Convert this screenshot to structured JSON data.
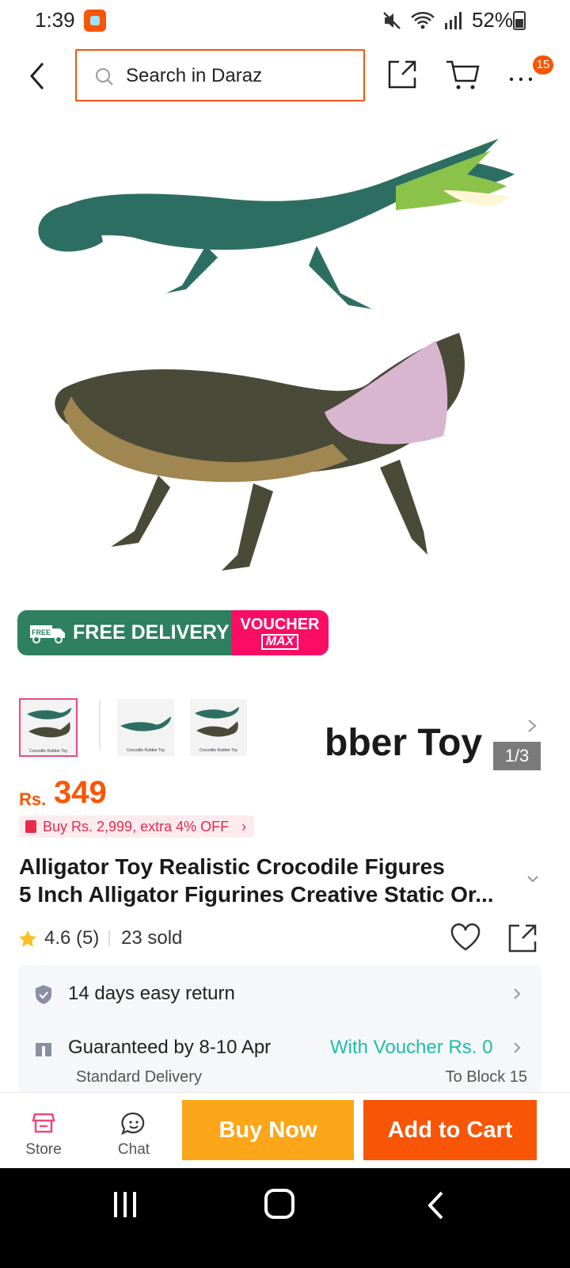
{
  "status_bar": {
    "time": "1:39",
    "battery": "52%"
  },
  "search": {
    "placeholder": "Search in Daraz"
  },
  "more_badge": "15",
  "hero": {
    "caption_fragment": "bber Toy",
    "image_counter": "1/3",
    "promo_free": "FREE DELIVERY",
    "promo_free_tag": "FREE",
    "promo_voucher_line1": "VOUCHER",
    "promo_voucher_line2": "MAX"
  },
  "thumbnails": [
    {
      "caption": "Crocodile Rubber Toy"
    },
    {
      "caption": "Crocodile Rubber Toy"
    },
    {
      "caption": "Crocodile Rubber Toy"
    }
  ],
  "price": {
    "currency": "Rs.",
    "value": "349"
  },
  "promo_chip": "Buy Rs. 2,999, extra 4% OFF",
  "product": {
    "title_line1": "Alligator Toy Realistic Crocodile Figures",
    "title_line2": "5 Inch Alligator Figurines Creative Static Or..."
  },
  "rating": {
    "score": "4.6",
    "count": "(5)",
    "sold": "23 sold"
  },
  "service": {
    "return": "14 days easy return",
    "delivery": "Guaranteed by 8-10 Apr",
    "voucher": "With Voucher Rs. 0",
    "delivery_type": "Standard Delivery",
    "location": "To Block 15"
  },
  "actions": {
    "store": "Store",
    "chat": "Chat",
    "buy_now": "Buy Now",
    "add_to_cart": "Add to Cart"
  },
  "colors": {
    "brand": "#f85606",
    "buy_now": "#fca619",
    "voucher_text": "#1cbfa6",
    "free_delivery": "#2e8060",
    "voucher_max": "#fc0d65"
  }
}
